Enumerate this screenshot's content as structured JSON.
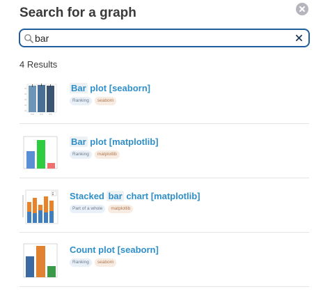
{
  "header": {
    "title": "Search for a graph"
  },
  "search": {
    "value": "bar",
    "placeholder": ""
  },
  "results": {
    "count_label": "4 Results",
    "items": [
      {
        "prefix": "",
        "highlight": "Bar",
        "suffix": " plot [seaborn]",
        "category": "Ranking",
        "library": "seaborn"
      },
      {
        "prefix": "",
        "highlight": "Bar",
        "suffix": " plot [matplotlib]",
        "category": "Ranking",
        "library": "matplotlib"
      },
      {
        "prefix": "Stacked ",
        "highlight": "bar",
        "suffix": " chart [matplotlib]",
        "category": "Part of a whole",
        "library": "matplotlib"
      },
      {
        "prefix": "Count plot [seaborn]",
        "highlight": "",
        "suffix": "",
        "category": "Ranking",
        "library": "seaborn"
      }
    ]
  },
  "colors": {
    "accent": "#2f8fc9",
    "search_border": "#1f5d9c",
    "seaborn_blue": "#4c72b0",
    "mpl_blue": "#4f86c6",
    "mpl_green": "#2ecc40",
    "mpl_red": "#f07070",
    "orange": "#e8832a"
  },
  "icons": {
    "close": "close-circle-icon",
    "search": "magnifier-icon",
    "clear": "x-icon"
  }
}
